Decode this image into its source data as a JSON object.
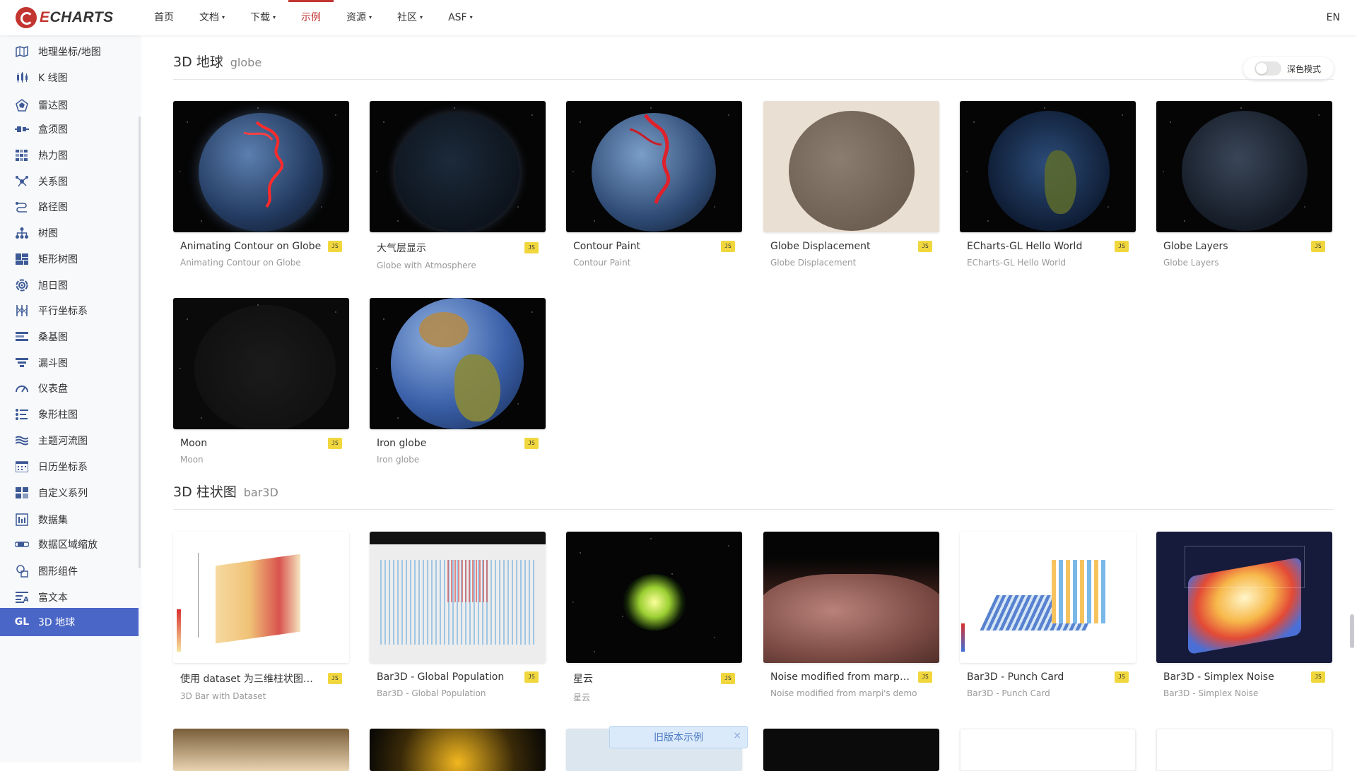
{
  "nav": {
    "logo_e": "E",
    "logo_rest": "CHARTS",
    "items": [
      {
        "label": "首页",
        "caret": ""
      },
      {
        "label": "文档",
        "caret": "▾"
      },
      {
        "label": "下载",
        "caret": "▾"
      },
      {
        "label": "示例",
        "caret": ""
      },
      {
        "label": "资源",
        "caret": "▾"
      },
      {
        "label": "社区",
        "caret": "▾"
      },
      {
        "label": "ASF",
        "caret": "▾"
      }
    ],
    "active_index": 3,
    "lang": "EN"
  },
  "sidebar": {
    "items": [
      {
        "label": "地理坐标/地图",
        "icon": "map-icon"
      },
      {
        "label": "K 线图",
        "icon": "candlestick-icon"
      },
      {
        "label": "雷达图",
        "icon": "radar-icon"
      },
      {
        "label": "盒须图",
        "icon": "boxplot-icon"
      },
      {
        "label": "热力图",
        "icon": "heatmap-icon"
      },
      {
        "label": "关系图",
        "icon": "graph-icon"
      },
      {
        "label": "路径图",
        "icon": "lines-icon"
      },
      {
        "label": "树图",
        "icon": "tree-icon"
      },
      {
        "label": "矩形树图",
        "icon": "treemap-icon"
      },
      {
        "label": "旭日图",
        "icon": "sunburst-icon"
      },
      {
        "label": "平行坐标系",
        "icon": "parallel-icon"
      },
      {
        "label": "桑基图",
        "icon": "sankey-icon"
      },
      {
        "label": "漏斗图",
        "icon": "funnel-icon"
      },
      {
        "label": "仪表盘",
        "icon": "gauge-icon"
      },
      {
        "label": "象形柱图",
        "icon": "pictorialbar-icon"
      },
      {
        "label": "主题河流图",
        "icon": "themeriver-icon"
      },
      {
        "label": "日历坐标系",
        "icon": "calendar-icon"
      },
      {
        "label": "自定义系列",
        "icon": "custom-icon"
      },
      {
        "label": "数据集",
        "icon": "dataset-icon"
      },
      {
        "label": "数据区域缩放",
        "icon": "datazoom-icon"
      },
      {
        "label": "图形组件",
        "icon": "graphic-icon"
      },
      {
        "label": "富文本",
        "icon": "richtext-icon"
      },
      {
        "label": "3D 地球",
        "icon": "gl-icon",
        "active": true,
        "icon_text": "GL"
      }
    ]
  },
  "dark_mode": {
    "label": "深色模式",
    "on": false
  },
  "sections": [
    {
      "title": "3D 地球",
      "sub": "globe",
      "cards": [
        {
          "title": "Animating Contour on Globe",
          "sub": "Animating Contour on Globe",
          "badge": "JS"
        },
        {
          "title": "大气层显示",
          "sub": "Globe with Atmosphere",
          "badge": "JS"
        },
        {
          "title": "Contour Paint",
          "sub": "Contour Paint",
          "badge": "JS"
        },
        {
          "title": "Globe Displacement",
          "sub": "Globe Displacement",
          "badge": "JS"
        },
        {
          "title": "ECharts-GL Hello World",
          "sub": "ECharts-GL Hello World",
          "badge": "JS"
        },
        {
          "title": "Globe Layers",
          "sub": "Globe Layers",
          "badge": "JS"
        },
        {
          "title": "Moon",
          "sub": "Moon",
          "badge": "JS"
        },
        {
          "title": "Iron globe",
          "sub": "Iron globe",
          "badge": "JS"
        }
      ]
    },
    {
      "title": "3D 柱状图",
      "sub": "bar3D",
      "cards": [
        {
          "title": "使用 dataset 为三维柱状图设...",
          "sub": "3D Bar with Dataset",
          "badge": "JS"
        },
        {
          "title": "Bar3D - Global Population",
          "sub": "Bar3D - Global Population",
          "badge": "JS"
        },
        {
          "title": "星云",
          "sub": "星云",
          "badge": "JS"
        },
        {
          "title": "Noise modified from marpi's ...",
          "sub": "Noise modified from marpi's demo",
          "badge": "JS"
        },
        {
          "title": "Bar3D - Punch Card",
          "sub": "Bar3D - Punch Card",
          "badge": "JS"
        },
        {
          "title": "Bar3D - Simplex Noise",
          "sub": "Bar3D - Simplex Noise",
          "badge": "JS"
        }
      ]
    }
  ],
  "old_version_banner": {
    "label": "旧版本示例",
    "close": "×"
  }
}
